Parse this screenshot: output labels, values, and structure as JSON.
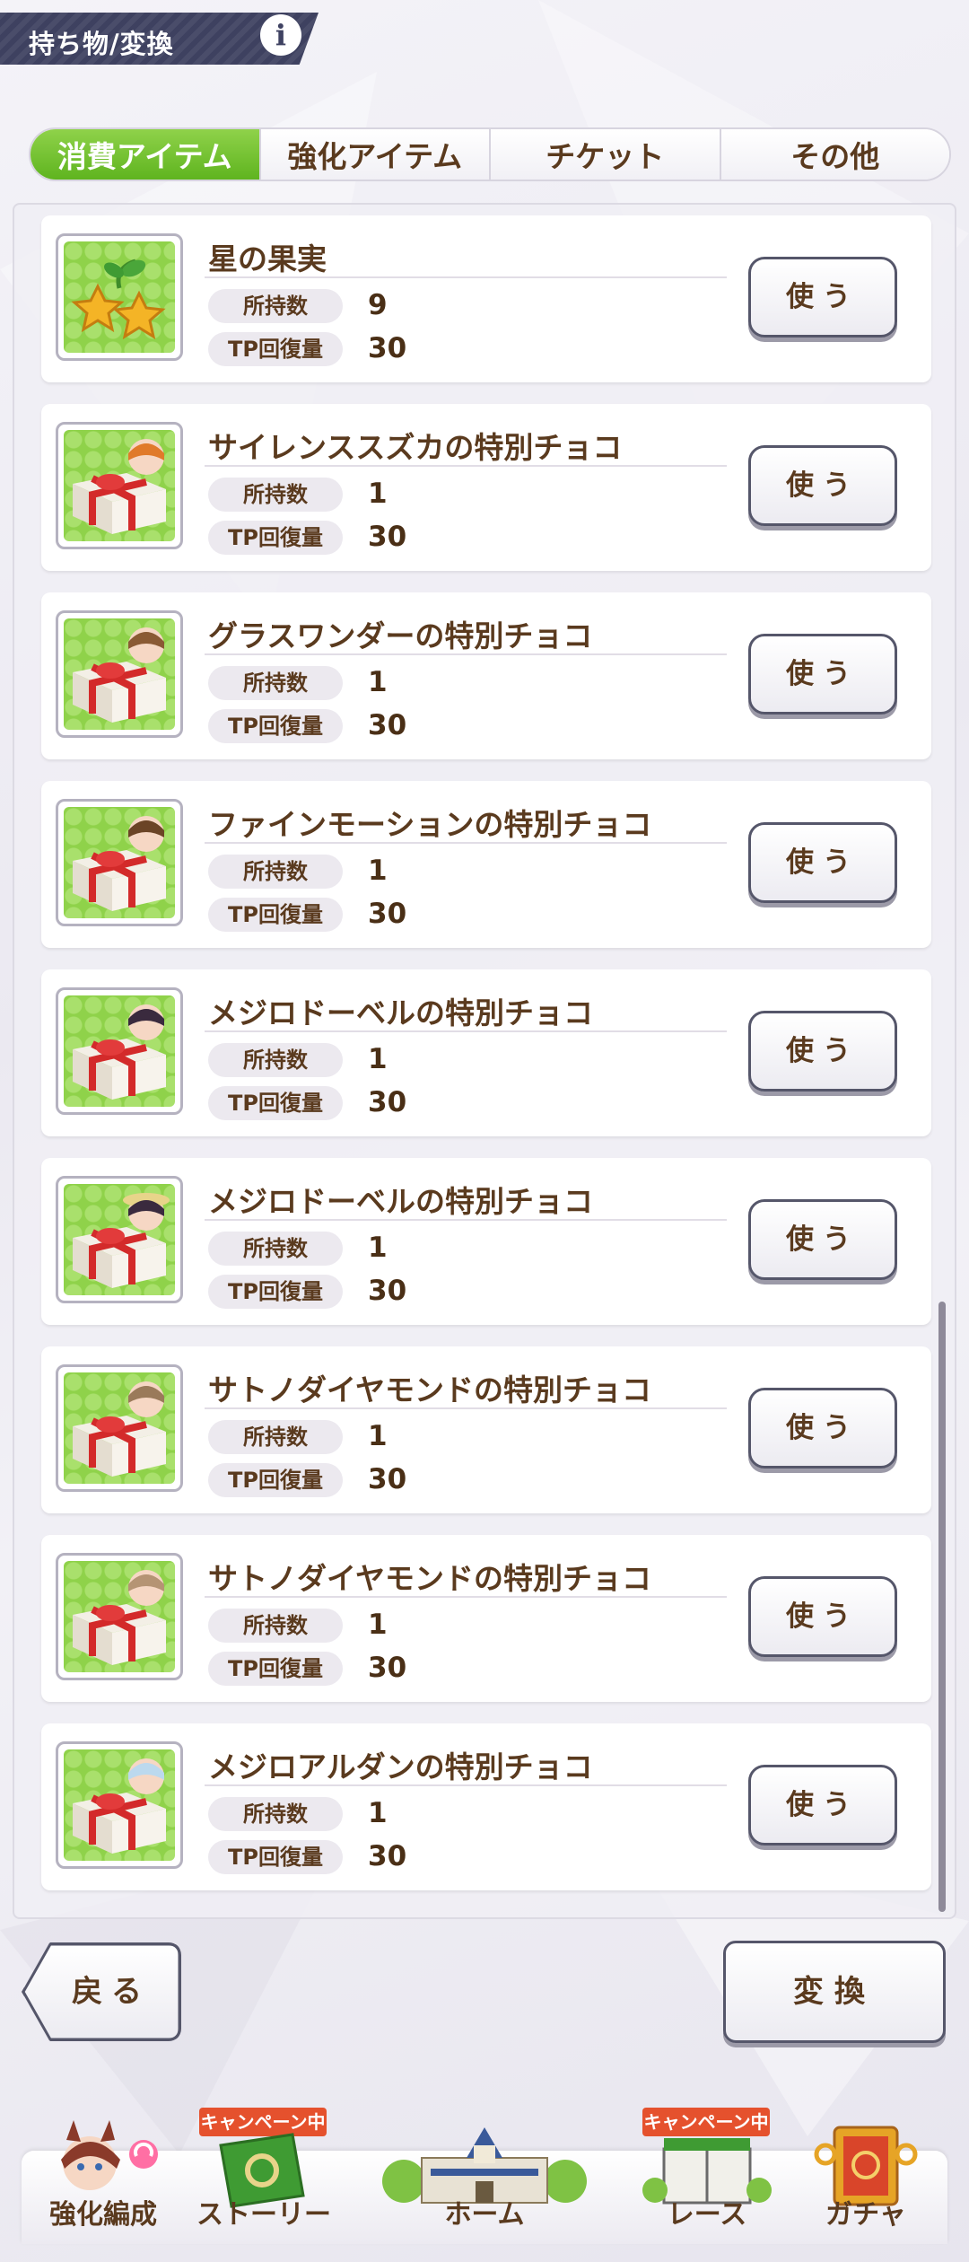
{
  "header": {
    "title": "持ち物/変換",
    "info_icon": "i"
  },
  "tabs": [
    {
      "label": "消費アイテム",
      "active": true
    },
    {
      "label": "強化アイテム",
      "active": false
    },
    {
      "label": "チケット",
      "active": false
    },
    {
      "label": "その他",
      "active": false
    }
  ],
  "labels": {
    "count": "所持数",
    "tp": "TP回復量",
    "use": "使う"
  },
  "items": [
    {
      "name": "星の果実",
      "count": "9",
      "tp": "30",
      "icon": "star-fruit-icon"
    },
    {
      "name": "サイレンススズカの特別チョコ",
      "count": "1",
      "tp": "30",
      "icon": "gift-box-icon"
    },
    {
      "name": "グラスワンダーの特別チョコ",
      "count": "1",
      "tp": "30",
      "icon": "gift-box-icon"
    },
    {
      "name": "ファインモーションの特別チョコ",
      "count": "1",
      "tp": "30",
      "icon": "gift-box-icon"
    },
    {
      "name": "メジロドーベルの特別チョコ",
      "count": "1",
      "tp": "30",
      "icon": "gift-box-icon"
    },
    {
      "name": "メジロドーベルの特別チョコ",
      "count": "1",
      "tp": "30",
      "icon": "gift-box-icon"
    },
    {
      "name": "サトノダイヤモンドの特別チョコ",
      "count": "1",
      "tp": "30",
      "icon": "gift-box-icon"
    },
    {
      "name": "サトノダイヤモンドの特別チョコ",
      "count": "1",
      "tp": "30",
      "icon": "gift-box-icon"
    },
    {
      "name": "メジロアルダンの特別チョコ",
      "count": "1",
      "tp": "30",
      "icon": "gift-box-icon"
    }
  ],
  "footer": {
    "back": "戻る",
    "convert": "変換"
  },
  "nav": {
    "campaign_badge": "キャンペーン中",
    "items": [
      {
        "label": "強化編成",
        "icon": "character-icon"
      },
      {
        "label": "ストーリー",
        "icon": "story-book-icon"
      },
      {
        "label": "ホーム",
        "icon": "school-building-icon"
      },
      {
        "label": "レース",
        "icon": "race-gate-icon"
      },
      {
        "label": "ガチャ",
        "icon": "gacha-door-icon"
      }
    ]
  },
  "colors": {
    "tab_active": "#6cc22c",
    "text_brown": "#5a3a1e",
    "header_bg": "#44475f",
    "badge": "#e5512d"
  }
}
